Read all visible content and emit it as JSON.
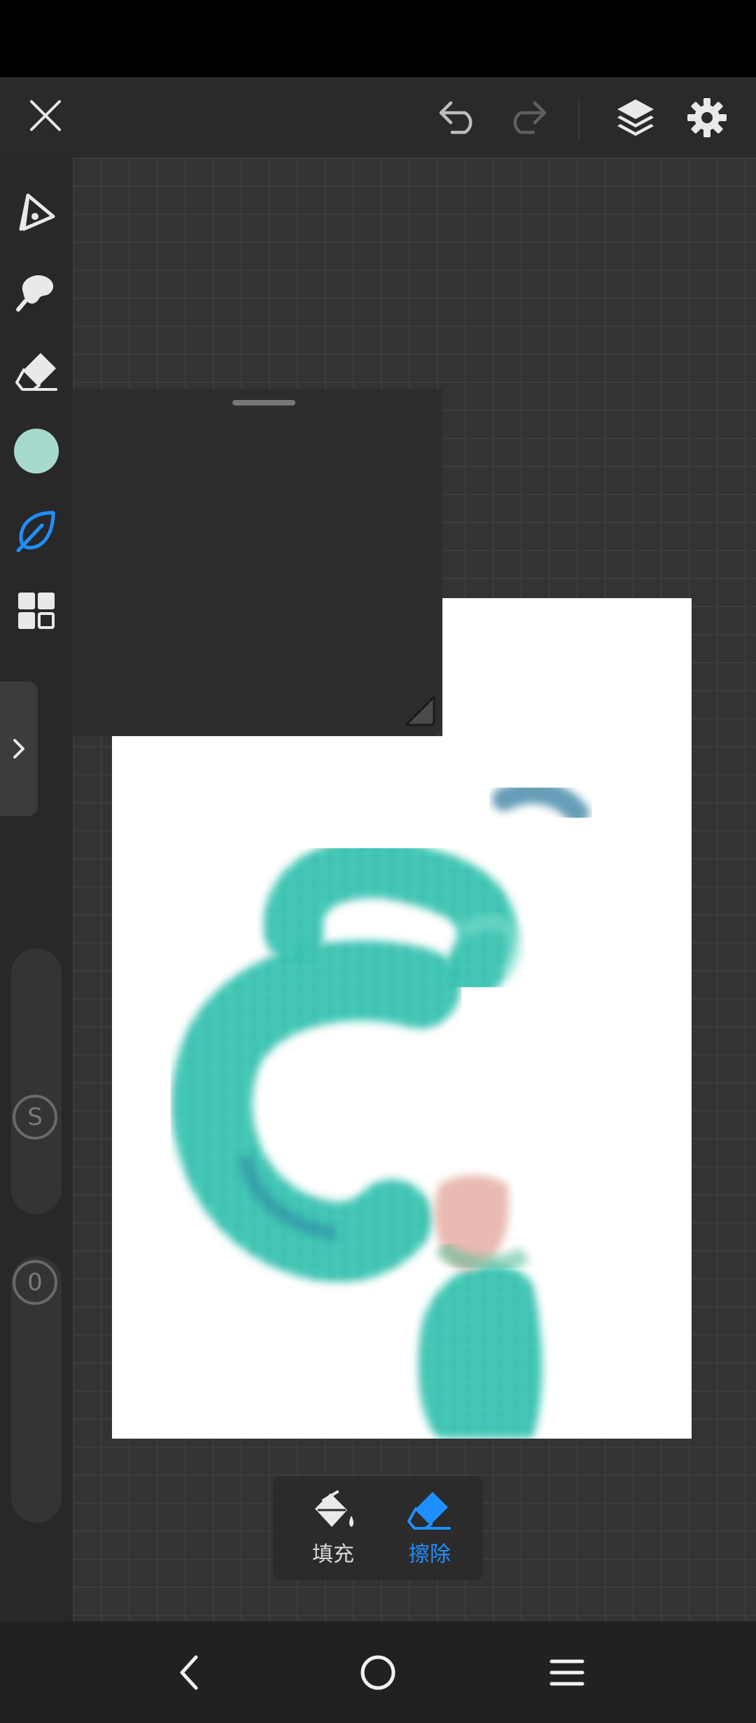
{
  "app": {
    "colors": {
      "accent": "#1f8fff",
      "current_brush_color": "#a8d9cd",
      "icon": "#e9e9e9",
      "icon_dim": "#6e6e6e"
    }
  },
  "top_bar": {
    "close_icon": "close-icon",
    "undo_icon": "undo-icon",
    "redo_icon": "redo-icon",
    "layers_icon": "layers-icon",
    "settings_icon": "gear-icon"
  },
  "left_toolbar": {
    "tools": [
      {
        "name": "pen",
        "icon": "pen-nib-icon"
      },
      {
        "name": "smudge",
        "icon": "smudge-icon"
      },
      {
        "name": "eraser",
        "icon": "eraser-icon"
      },
      {
        "name": "color",
        "icon": "color-swatch"
      },
      {
        "name": "brush",
        "icon": "leaf-brush-icon",
        "active": true
      },
      {
        "name": "gallery",
        "icon": "grid-icon"
      }
    ],
    "size_slider_label": "S",
    "opacity_slider_label": "0"
  },
  "bottom_popup": {
    "fill_label": "填充",
    "erase_label": "擦除",
    "active": "erase"
  },
  "nav_bar": {
    "back_icon": "back-icon",
    "home_icon": "home-icon",
    "menu_icon": "menu-icon"
  }
}
